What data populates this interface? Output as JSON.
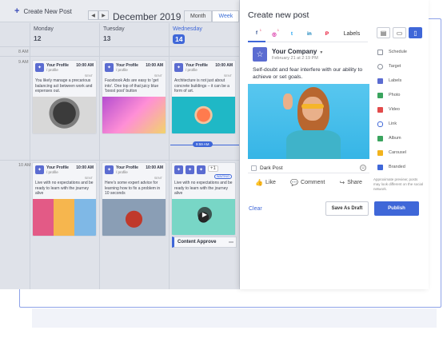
{
  "calendar": {
    "create_label": "Create New Post",
    "month": "December 2019",
    "views": [
      "Month",
      "Week"
    ],
    "days": [
      {
        "name": "Monday",
        "num": "12"
      },
      {
        "name": "Tuesday",
        "num": "13"
      },
      {
        "name": "Wednesday",
        "num": "14"
      }
    ],
    "times": [
      "8 AM",
      "9 AM",
      "10 AM"
    ],
    "now_time": "9:59 AM",
    "posts_9am": [
      {
        "profile": "Your Profile",
        "sub": "/ profile",
        "time": "10:00 AM",
        "status": "SENT",
        "text": "You likely manage a precarious balancing act between work and expenses out."
      },
      {
        "profile": "Your Profile",
        "sub": "/ profile",
        "time": "10:00 AM",
        "status": "SENT",
        "text": "Facebook Ads are easy to 'get into'. One top of that juicy blue 'boost post' button"
      },
      {
        "profile": "Your Profile",
        "sub": "/ profile",
        "time": "10:00 AM",
        "status": "SENT",
        "text": "Architecture is not just about concrete buildings – it can be a form of art."
      }
    ],
    "posts_10am": [
      {
        "profile": "Your Profile",
        "sub": "/ profile",
        "time": "10:00 AM",
        "status": "SENT",
        "text": "Live with no expectations and be ready to learn with the journey alive"
      },
      {
        "profile": "Your Profile",
        "sub": "/ profile",
        "time": "10:00 AM",
        "status": "SENT",
        "text": "Here's some expert advice for learning how to fix a problem in 10 seconds"
      },
      {
        "profile": "",
        "sub": "",
        "time": "",
        "status": "WAITING",
        "text": "Live with no expectations and be ready to learn with the journey alive"
      }
    ],
    "extra_count": "+1",
    "approve_label": "Content Approve"
  },
  "panel": {
    "title": "Create new post",
    "tabs": [
      {
        "icon": "facebook-icon",
        "glyph": "f",
        "color": "#3b5998",
        "badge": "1"
      },
      {
        "icon": "instagram-icon",
        "glyph": "◎",
        "color": "#d6249f",
        "badge": "1"
      },
      {
        "icon": "twitter-icon",
        "glyph": "t",
        "color": "#1da1f2",
        "badge": ""
      },
      {
        "icon": "linkedin-icon",
        "glyph": "in",
        "color": "#0077b5",
        "badge": ""
      },
      {
        "icon": "pinterest-icon",
        "glyph": "P",
        "color": "#e60023",
        "badge": ""
      }
    ],
    "labels_tab": "Labels",
    "preview": {
      "company": "Your Company",
      "date": "February 21 at 2:19 PM",
      "text": "Self-doubt and fear interfere with our ability to achieve or set goals.",
      "dark_post": "Dark Post",
      "like": "Like",
      "comment": "Comment",
      "share": "Share"
    },
    "options": [
      {
        "label": "Schedule",
        "color": "#8a8f9a"
      },
      {
        "label": "Target",
        "color": "#8a8f9a"
      },
      {
        "label": "Labels",
        "color": "#5b6cd1"
      },
      {
        "label": "Photo",
        "color": "#3aa45e"
      },
      {
        "label": "Video",
        "color": "#e24b4b"
      },
      {
        "label": "Link",
        "color": "#3f67d8"
      },
      {
        "label": "Album",
        "color": "#3aa45e"
      },
      {
        "label": "Carousel",
        "color": "#f2b31d"
      },
      {
        "label": "Branded",
        "color": "#3f67d8"
      }
    ],
    "note": "Approximate preview; posts may look different on the social network.",
    "clear": "Clear",
    "save_draft": "Save As Draft",
    "publish": "Publish"
  }
}
